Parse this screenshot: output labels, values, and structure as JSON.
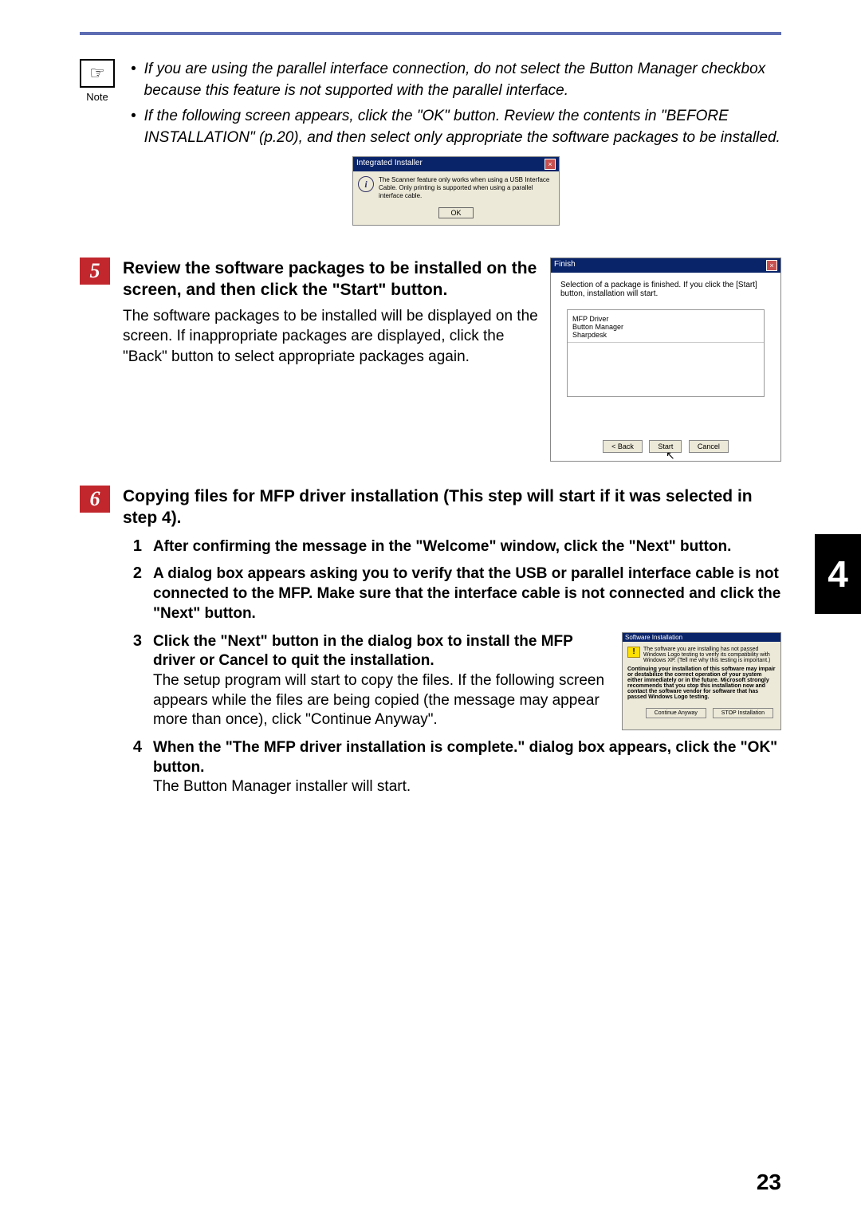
{
  "note": {
    "label": "Note",
    "icon_glyph": "☞",
    "bullets": [
      "If you are using the parallel interface connection, do not select the Button Manager checkbox because this feature is not supported with the parallel interface.",
      "If the following screen appears, click the \"OK\" button. Review the contents in \"BEFORE INSTALLATION\" (p.20), and then select only appropriate the software packages to be installed."
    ]
  },
  "dialog1": {
    "title": "Integrated Installer",
    "text": "The Scanner feature only works when using a USB Interface Cable. Only printing is supported when using a parallel interface cable.",
    "ok": "OK"
  },
  "step5": {
    "num": "5",
    "heading": "Review the software packages to be installed on the screen, and then click the \"Start\" button.",
    "text": "The software packages to be installed will be displayed on the screen. If inappropriate packages are displayed, click the \"Back\" button to select appropriate packages again.",
    "dialog": {
      "title": "Finish",
      "text": "Selection of a package is finished. If you click the [Start] button, installation will start.",
      "items": [
        "MFP Driver",
        "Button Manager",
        "Sharpdesk"
      ],
      "back": "< Back",
      "start": "Start",
      "cancel": "Cancel"
    }
  },
  "side_tab": "4",
  "step6": {
    "num": "6",
    "heading": "Copying files for MFP driver installation (This step will start if it was selected in step 4).",
    "subs": [
      {
        "num": "1",
        "heading": "After confirming the message in the \"Welcome\" window, click the \"Next\" button."
      },
      {
        "num": "2",
        "heading": "A dialog box appears asking you to verify that the USB or parallel interface cable is not connected to the MFP. Make sure that the interface cable is not connected and click the \"Next\" button."
      },
      {
        "num": "3",
        "heading": "Click the \"Next\" button in the dialog box to install the MFP driver or Cancel to quit the installation.",
        "text": "The setup program will start to copy the files. If the following screen appears while the files are being copied (the message may appear more than once), click \"Continue Anyway\"."
      },
      {
        "num": "4",
        "heading": "When the \"The MFP driver installation is complete.\" dialog box appears, click the \"OK\" button.",
        "text": "The Button Manager installer will start."
      }
    ]
  },
  "warn_dialog": {
    "title": "Software Installation",
    "line1": "The software you are installing has not passed Windows Logo testing to verify its compatibility with Windows XP. (Tell me why this testing is important.)",
    "line2": "Continuing your installation of this software may impair or destabilize the correct operation of your system either immediately or in the future. Microsoft strongly recommends that you stop this installation now and contact the software vendor for software that has passed Windows Logo testing.",
    "btn_continue": "Continue Anyway",
    "btn_stop": "STOP Installation"
  },
  "page_num": "23"
}
